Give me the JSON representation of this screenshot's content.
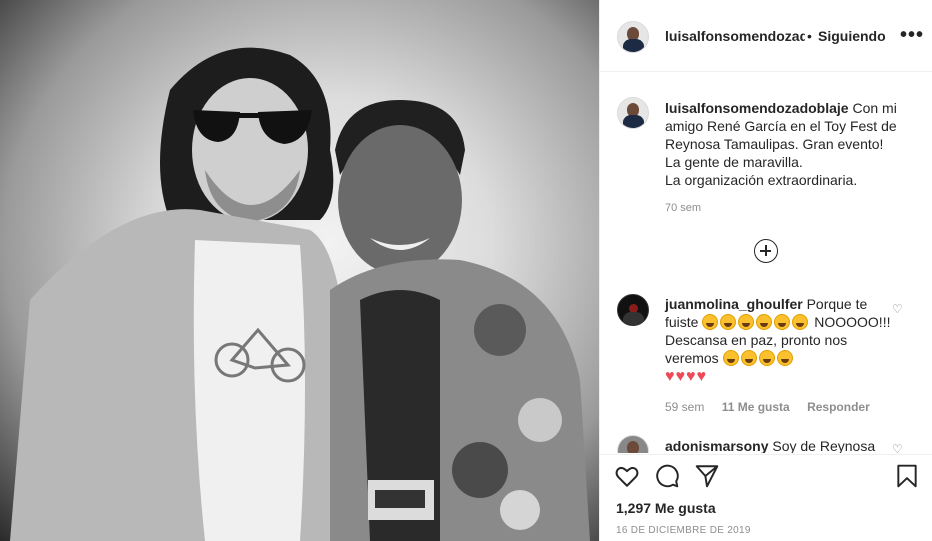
{
  "post": {
    "username": "luisalfonsomendozadoblaje",
    "username_truncated": "luisalfonsomendozadc",
    "dot": "•",
    "follow_status": "Siguiendo",
    "more_icon": "•••"
  },
  "caption": {
    "username": "luisalfonsomendozadoblaje",
    "text": "Con mi amigo René García en el Toy Fest de Reynosa Tamaulipas. Gran evento!",
    "line2": "La gente de maravilla.",
    "line3": "La organización extraordinaria.",
    "time": "70 sem"
  },
  "comments": [
    {
      "username": "juanmolina_ghoulfer",
      "text_a": "Porque te fuiste",
      "text_b": "NOOOOO!!! Descansa en paz, pronto nos veremos",
      "hearts": "♥♥♥♥",
      "time": "59 sem",
      "likes": "11 Me gusta",
      "reply": "Responder",
      "like_icon": "♡"
    },
    {
      "username": "adonismarsony",
      "text": "Soy de Reynosa",
      "like_icon": "♡"
    }
  ],
  "footer": {
    "likes": "1,297 Me gusta",
    "date": "16 DE DICIEMBRE DE 2019"
  },
  "icons": {
    "like": "heart-icon",
    "comment": "comment-icon",
    "share": "share-icon",
    "save": "bookmark-icon",
    "load_more": "plus-circle-icon"
  },
  "colors": {
    "text": "#262626",
    "muted": "#8e8e8e",
    "border": "#efefef",
    "heart": "#ed4956"
  }
}
